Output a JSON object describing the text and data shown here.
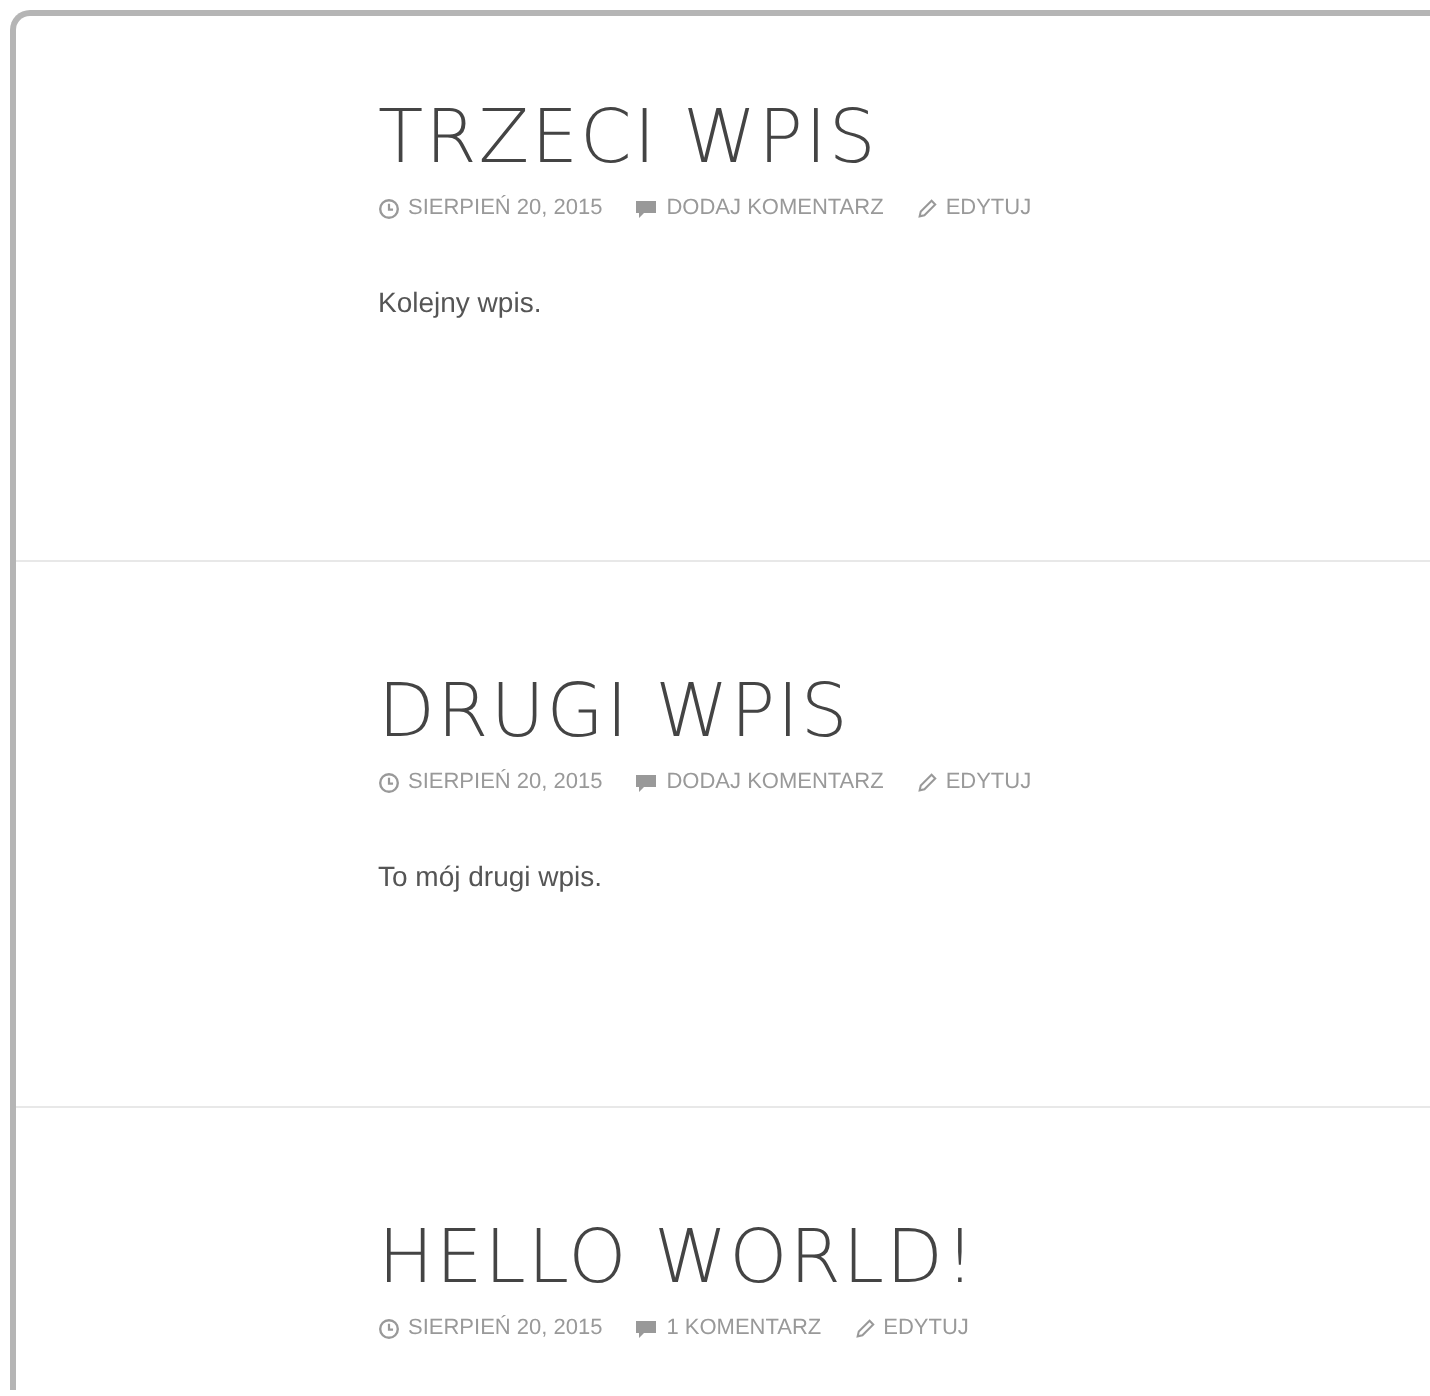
{
  "posts": [
    {
      "title": "TRZECI WPIS",
      "date": "SIERPIEŃ 20, 2015",
      "comments": "DODAJ KOMENTARZ",
      "edit": "EDYTUJ",
      "excerpt": "Kolejny wpis."
    },
    {
      "title": "DRUGI WPIS",
      "date": "SIERPIEŃ 20, 2015",
      "comments": "DODAJ KOMENTARZ",
      "edit": "EDYTUJ",
      "excerpt": "To mój drugi wpis."
    },
    {
      "title": "HELLO WORLD!",
      "date": "SIERPIEŃ 20, 2015",
      "comments": "1 KOMENTARZ",
      "edit": "EDYTUJ"
    }
  ]
}
